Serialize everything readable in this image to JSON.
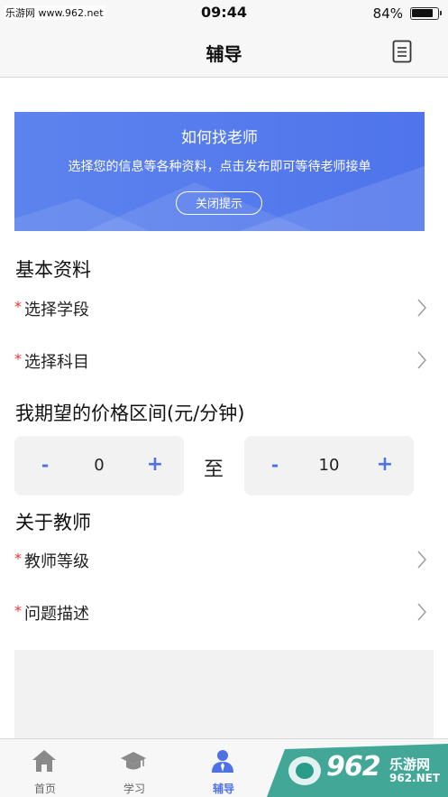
{
  "status_bar": {
    "watermark": "乐游网 www.962.net",
    "time": "09:44",
    "battery_percent": "84%",
    "battery_level": 0.84
  },
  "nav": {
    "title": "辅导",
    "right_icon": "document-list-icon"
  },
  "banner": {
    "title": "如何找老师",
    "subtitle": "选择您的信息等各种资料，点击发布即可等待老师接单",
    "close_label": "关闭提示",
    "color_left": "#5d83ee",
    "color_right": "#4f74ec"
  },
  "basic_info": {
    "title": "基本资料",
    "rows": [
      {
        "required": "*",
        "label": "选择学段"
      },
      {
        "required": "*",
        "label": "选择科目"
      }
    ]
  },
  "price": {
    "title": "我期望的价格区间(元/分钟)",
    "min": {
      "minus": "-",
      "value": "0",
      "plus": "+"
    },
    "to_label": "至",
    "max": {
      "minus": "-",
      "value": "10",
      "plus": "+"
    }
  },
  "teacher": {
    "title": "关于教师",
    "rows": [
      {
        "required": "*",
        "label": "教师等级"
      },
      {
        "required": "*",
        "label": "问题描述"
      }
    ]
  },
  "tab_bar": {
    "active_color": "#4e71e6",
    "tabs": [
      {
        "label": "首页",
        "icon": "home-icon"
      },
      {
        "label": "学习",
        "icon": "graduation-cap-icon"
      },
      {
        "label": "辅导",
        "icon": "tutor-person-icon"
      }
    ]
  },
  "watermark_bottom": {
    "brand_number": "962",
    "brand_cn": "乐游网",
    "brand_en": "962.NET"
  }
}
